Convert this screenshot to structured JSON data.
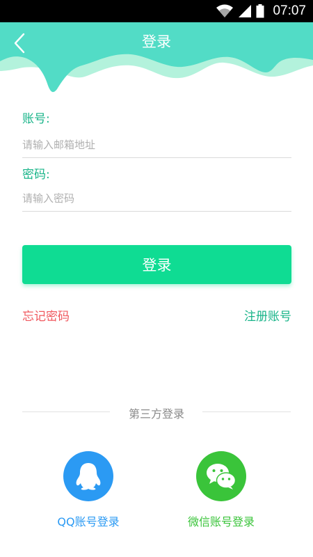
{
  "status_bar": {
    "time": "07:07"
  },
  "header": {
    "title": "登录"
  },
  "form": {
    "account_label": "账号:",
    "account_placeholder": "请输入邮箱地址",
    "password_label": "密码:",
    "password_placeholder": "请输入密码",
    "login_button": "登录",
    "forgot_password": "忘记密码",
    "register": "注册账号"
  },
  "third_party": {
    "title": "第三方登录",
    "qq_label": "QQ账号登录",
    "wechat_label": "微信账号登录"
  },
  "colors": {
    "header_teal": "#4fdcc4",
    "accent_green": "#0fdc93",
    "label_green": "#18b489",
    "forgot_red": "#f0585e",
    "qq_blue": "#2b9af3",
    "wechat_green": "#3ac43a"
  },
  "icons": {
    "back": "chevron-left-icon",
    "wifi": "wifi-icon",
    "signal": "signal-icon",
    "battery": "battery-icon",
    "qq": "qq-penguin-icon",
    "wechat": "wechat-bubbles-icon"
  }
}
